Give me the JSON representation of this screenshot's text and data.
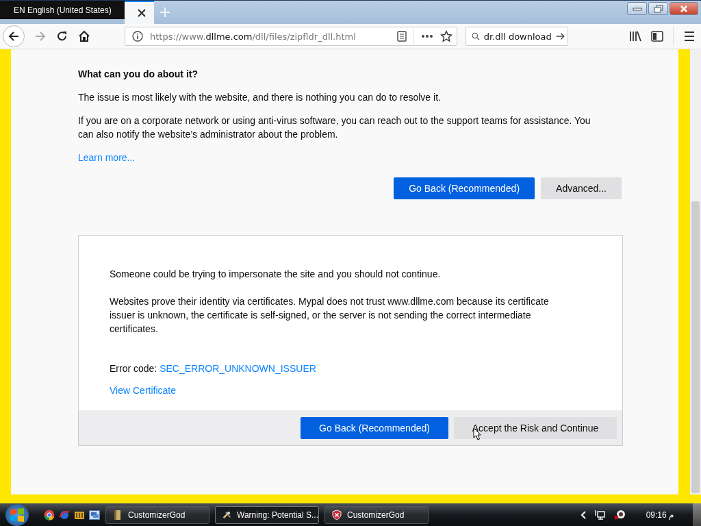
{
  "language_bar": {
    "text": "EN English (United States)"
  },
  "address_bar": {
    "scheme": "https://www.",
    "domain": "dllme.com",
    "path": "/dll/files/zipfldr_dll.html"
  },
  "search": {
    "value": "dr.dll download"
  },
  "error": {
    "heading": "What can you do about it?",
    "paragraphs": [
      "The issue is most likely with the website, and there is nothing you can do to resolve it.",
      "If you are on a corporate network or using anti-virus software, you can reach out to the support teams for assistance. You can also notify the website’s administrator about the problem."
    ],
    "learn_more": "Learn more...",
    "buttons": [
      {
        "label": "Go Back (Recommended)",
        "kind": "primary"
      },
      {
        "label": "Advanced...",
        "kind": "secondary"
      }
    ]
  },
  "advanced_panel": {
    "paragraphs": [
      "Someone could be trying to impersonate the site and you should not continue.",
      "Websites prove their identity via certificates. Mypal does not trust www.dllme.com because its certificate issuer is unknown, the certificate is self-signed, or the server is not sending the correct intermediate certificates."
    ],
    "error_code_label": "Error code: ",
    "error_code": "SEC_ERROR_UNKNOWN_ISSUER",
    "view_certificate": "View Certificate",
    "buttons": [
      {
        "label": "Go Back (Recommended)",
        "kind": "primary"
      },
      {
        "label": "Accept the Risk and Continue",
        "kind": "secondary"
      }
    ]
  },
  "taskbar": {
    "tasks": [
      {
        "label": "CustomizerGod",
        "selected": false,
        "kind": "folder"
      },
      {
        "label": "Warning: Potential S...",
        "selected": true,
        "kind": "browser"
      },
      {
        "label": "CustomizerGod",
        "selected": false,
        "kind": "shield"
      }
    ],
    "clock": "09:16 م"
  }
}
